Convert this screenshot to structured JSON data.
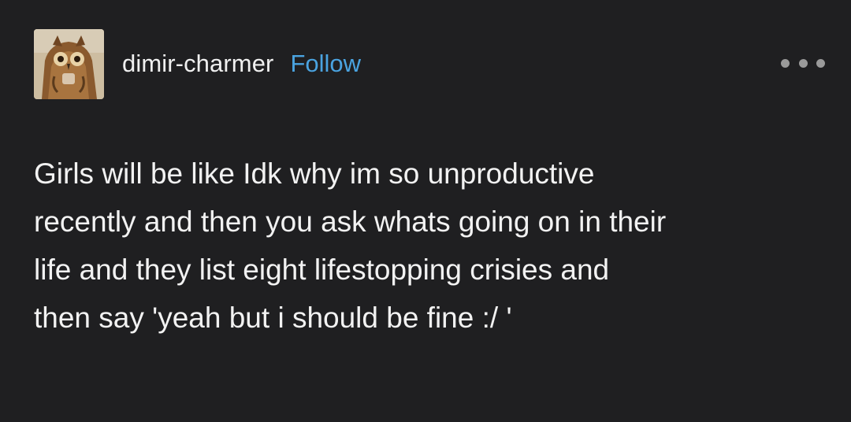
{
  "post": {
    "username": "dimir-charmer",
    "follow_label": "Follow",
    "more_icon": "ellipsis-icon",
    "avatar_icon": "owl-avatar",
    "body_lines": [
      "Girls will be like Idk why im so unproductive",
      "recently and then you ask whats going on in their",
      "life and they list eight lifestopping crisies and",
      "then say 'yeah but i should be fine :/ '"
    ]
  },
  "colors": {
    "background": "#1f1f21",
    "text": "#f2f2f2",
    "follow": "#4aa3e0",
    "more_dots": "#9a9a9a"
  }
}
